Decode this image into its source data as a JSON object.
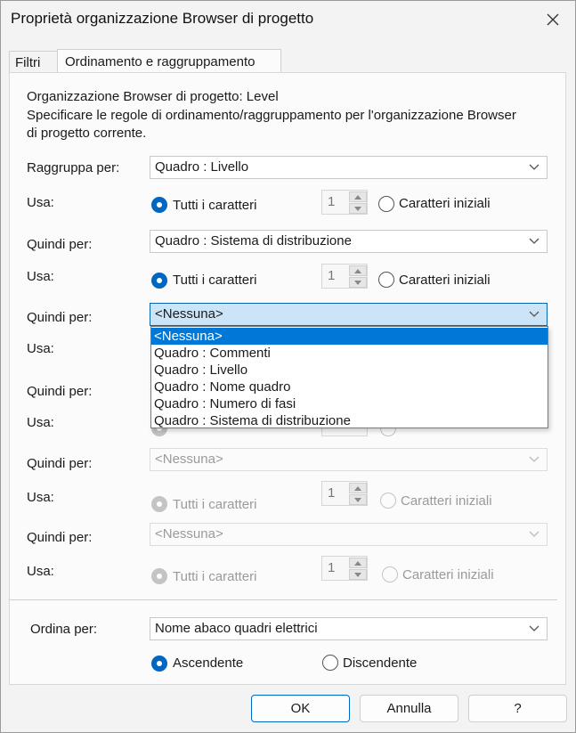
{
  "window": {
    "title": "Proprietà organizzazione Browser di progetto"
  },
  "tabs": [
    {
      "label": "Filtri"
    },
    {
      "label": "Ordinamento e raggruppamento"
    }
  ],
  "header": {
    "line1": "Organizzazione Browser di progetto: Level",
    "line2": "Specificare le regole di ordinamento/raggruppamento per l'organizzazione Browser",
    "line3": "di progetto corrente."
  },
  "groups": [
    {
      "label": "Raggruppa per:",
      "value": "Quadro : Livello",
      "use_label": "Usa:",
      "all_chars": "Tutti i caratteri",
      "count": "1",
      "initial_chars": "Caratteri iniziali"
    },
    {
      "label": "Quindi per:",
      "value": "Quadro : Sistema di distribuzione",
      "use_label": "Usa:",
      "all_chars": "Tutti i caratteri",
      "count": "1",
      "initial_chars": "Caratteri iniziali"
    },
    {
      "label": "Quindi per:",
      "value": "<Nessuna>",
      "use_label": "Usa:"
    },
    {
      "label": "Quindi per:",
      "use_label": "Usa:"
    },
    {
      "label": "Quindi per:",
      "value": "<Nessuna>",
      "use_label": "Usa:",
      "all_chars": "Tutti i caratteri",
      "count": "1",
      "initial_chars": "Caratteri iniziali"
    },
    {
      "label": "Quindi per:",
      "value": "<Nessuna>",
      "use_label": "Usa:",
      "all_chars": "Tutti i caratteri",
      "count": "1",
      "initial_chars": "Caratteri iniziali"
    }
  ],
  "dropdown_options": [
    "<Nessuna>",
    "Quadro : Commenti",
    "Quadro : Livello",
    "Quadro : Nome quadro",
    "Quadro : Numero di fasi",
    "Quadro : Sistema di distribuzione"
  ],
  "sort": {
    "label": "Ordina per:",
    "value": "Nome abaco quadri elettrici",
    "ascending": "Ascendente",
    "descending": "Discendente"
  },
  "buttons": {
    "ok": "OK",
    "cancel": "Annulla",
    "help": "?"
  },
  "colors": {
    "accent": "#0067c0",
    "selected_option": "#0078d7",
    "open_combo": "#cce4f7"
  }
}
